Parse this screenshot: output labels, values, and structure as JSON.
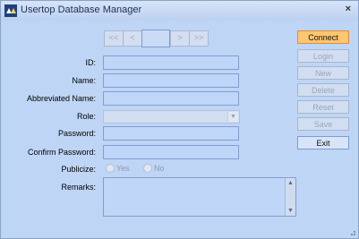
{
  "window": {
    "title": "Usertop Database Manager",
    "close_glyph": "×",
    "icon": "app-logo-icon"
  },
  "nav": {
    "first": "<<",
    "prev": "<",
    "next": ">",
    "last": ">>",
    "record_value": ""
  },
  "form": {
    "id_label": "ID:",
    "name_label": "Name:",
    "abbrev_label": "Abbreviated Name:",
    "role_label": "Role:",
    "password_label": "Password:",
    "confirm_label": "Confirm Password:",
    "publicize_label": "Publicize:",
    "remarks_label": "Remarks:",
    "id_value": "",
    "name_value": "",
    "abbrev_value": "",
    "role_value": "",
    "password_value": "",
    "confirm_value": "",
    "remarks_value": "",
    "publicize_yes": "Yes",
    "publicize_no": "No"
  },
  "actions": {
    "connect": "Connect",
    "login": "Login",
    "new": "New",
    "delete": "Delete",
    "reset": "Reset",
    "save": "Save",
    "exit": "Exit"
  },
  "colors": {
    "accent": "#ffc56f",
    "background": "#bfd5f6"
  }
}
